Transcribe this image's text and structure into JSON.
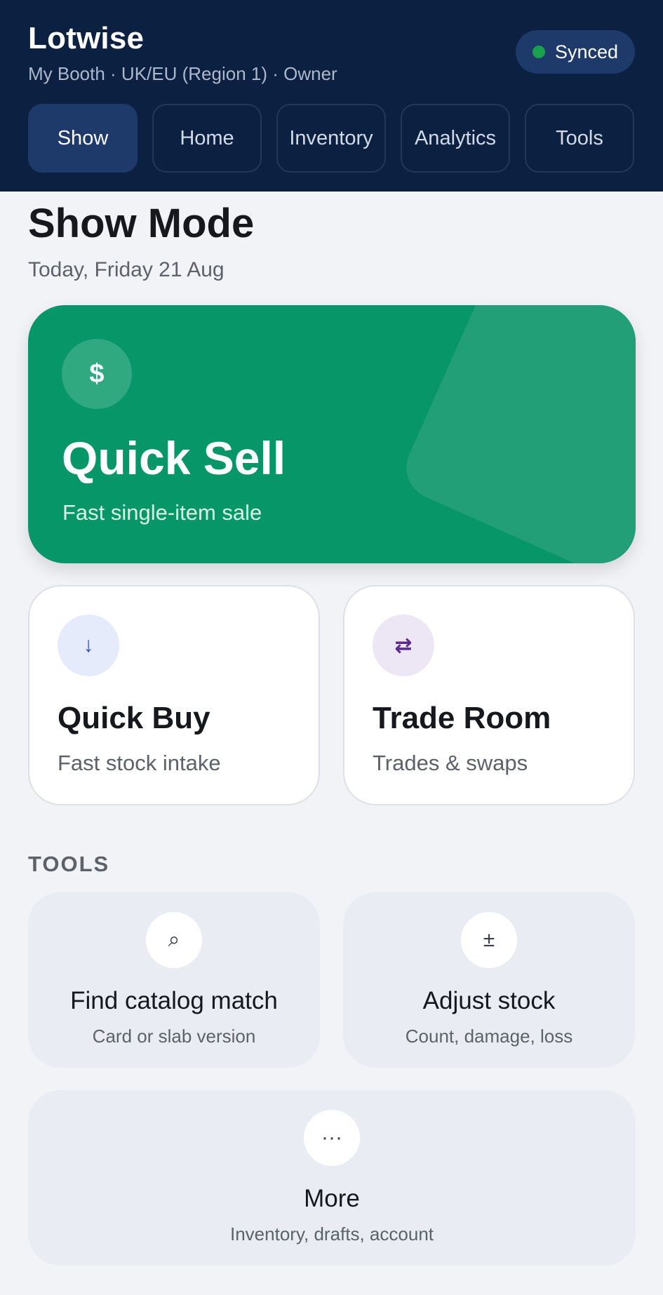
{
  "app": {
    "title": "Lotwise",
    "subtitle": "My Booth · UK/EU (Region 1) · Owner",
    "sync_status": "Synced",
    "sync_color": "#19a150"
  },
  "tabs": [
    {
      "label": "Show",
      "active": true
    },
    {
      "label": "Home",
      "active": false
    },
    {
      "label": "Inventory",
      "active": false
    },
    {
      "label": "Analytics",
      "active": false
    },
    {
      "label": "Tools",
      "active": false
    }
  ],
  "page": {
    "title": "Show Mode",
    "date": "Today, Friday 21 Aug"
  },
  "quick_sell": {
    "icon": "dollar-icon",
    "icon_glyph": "$",
    "title": "Quick Sell",
    "subtitle": "Fast single-item sale",
    "color": "#069668"
  },
  "quick_buy": {
    "icon": "arrow-down-icon",
    "icon_glyph": "↓",
    "title": "Quick Buy",
    "subtitle": "Fast stock intake",
    "icon_color": "#2d4fb8",
    "icon_bg": "#e5ebfa"
  },
  "trade_room": {
    "icon": "swap-arrows-icon",
    "icon_glyph": "⇄",
    "title": "Trade Room",
    "subtitle": "Trades & swaps",
    "icon_color": "#5b2b8c",
    "icon_bg": "#ede6f4"
  },
  "tools": {
    "section_label": "TOOLS",
    "find_match": {
      "icon": "search-icon",
      "icon_glyph": "⌕",
      "title": "Find catalog match",
      "subtitle": "Card or slab version"
    },
    "adjust_stock": {
      "icon": "plus-minus-icon",
      "icon_glyph": "±",
      "title": "Adjust stock",
      "subtitle": "Count, damage, loss"
    },
    "more": {
      "icon": "more-dots-icon",
      "icon_glyph": "···",
      "title": "More",
      "subtitle": "Inventory, drafts, account"
    }
  }
}
